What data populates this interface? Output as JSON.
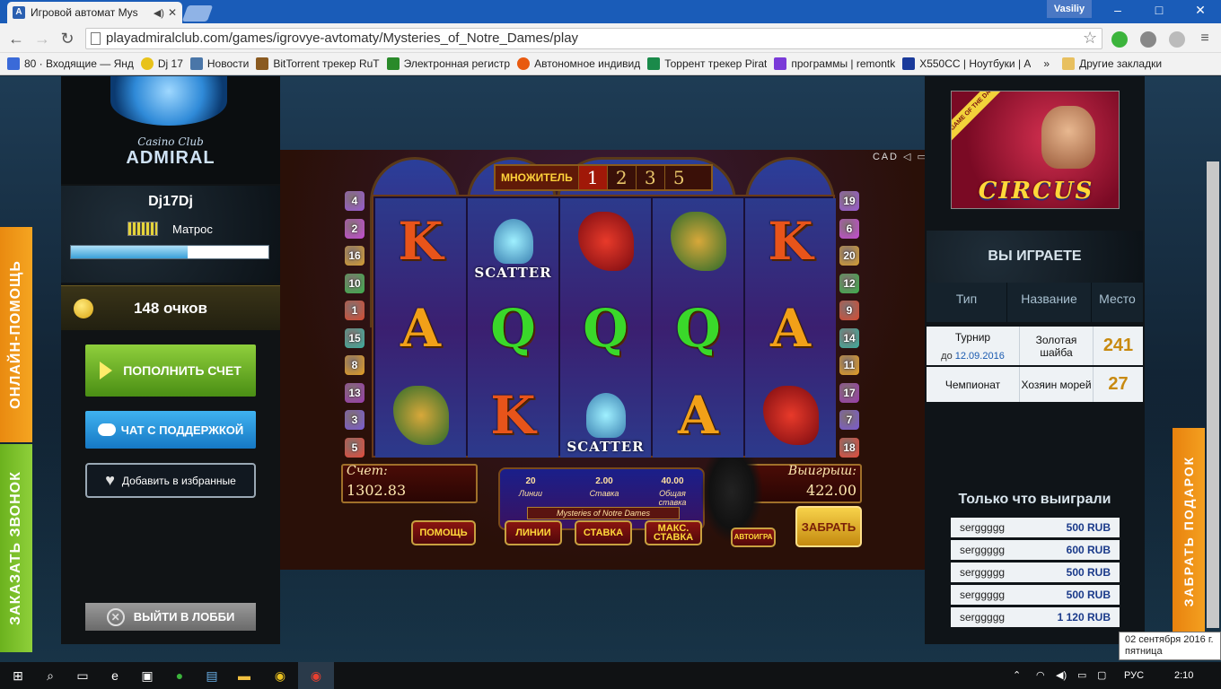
{
  "browser": {
    "tab_title": "Игровой автомат Mys",
    "tab_favicon": "A",
    "user": "Vasiliy",
    "window_controls": [
      "–",
      "□",
      "✕"
    ],
    "url": "playadmiralclub.com/games/igrovye-avtomaty/Mysteries_of_Notre_Dames/play",
    "bookmarks": [
      {
        "label": "80 · Входящие — Янд",
        "color": "#3a6ad8"
      },
      {
        "label": "Dj 17",
        "color": "#e8c21a"
      },
      {
        "label": "Новости",
        "color": "#4a76a8"
      },
      {
        "label": "BitTorrent трекер RuT",
        "color": "#8a5a20"
      },
      {
        "label": "Электронная регистр",
        "color": "#2a8a2a"
      },
      {
        "label": "Автономное индивид",
        "color": "#e85a10"
      },
      {
        "label": "Торрент трекер Pirat",
        "color": "#1a8a4a"
      },
      {
        "label": "программы | remontk",
        "color": "#7a3ad8"
      },
      {
        "label": "X550CC | Ноутбуки | A",
        "color": "#1a3a9a"
      }
    ],
    "bookmarks_more": "»",
    "other_bookmarks": "Другие закладки"
  },
  "casino": {
    "logo_sub": "Casino Club",
    "logo_main": "ADMIRAL",
    "username": "Dj17Dj",
    "rank": "Матрос",
    "level_progress": 0.59,
    "points": "148 очков",
    "btn_fill": "ПОПОЛНИТЬ СЧЕТ",
    "btn_chat": "ЧАТ С ПОДДЕРЖКОЙ",
    "btn_fav": "Добавить в избранные",
    "btn_exit": "ВЫЙТИ В ЛОББИ",
    "side_online": "ОНЛАЙН-ПОМОЩЬ",
    "side_call": "ЗАКАЗАТЬ ЗВОНОК",
    "side_gift": "ЗАБРАТЬ ПОДАРОК"
  },
  "game": {
    "multiplier_label": "МНОЖИТЕЛЬ",
    "multipliers": [
      "1",
      "2",
      "3",
      "5"
    ],
    "top_icons": "САD ◁ ▭ ⤢",
    "left_gems": [
      "4",
      "2",
      "16",
      "10",
      "1",
      "15",
      "8",
      "13",
      "3",
      "5"
    ],
    "right_gems": [
      "19",
      "6",
      "20",
      "12",
      "9",
      "14",
      "11",
      "17",
      "7",
      "18"
    ],
    "reels": [
      [
        {
          "t": "K",
          "c": "#e8541a"
        },
        {
          "t": "A",
          "c": "#f2a018"
        },
        {
          "t": "dragon-green"
        }
      ],
      [
        {
          "t": "goblet",
          "scatter": "SCATTER"
        },
        {
          "t": "Q",
          "c": "#3ad82a"
        },
        {
          "t": "K",
          "c": "#e8541a"
        }
      ],
      [
        {
          "t": "dragon-red"
        },
        {
          "t": "Q",
          "c": "#3ad82a"
        },
        {
          "t": "goblet",
          "scatter": "SCATTER"
        }
      ],
      [
        {
          "t": "dragon-green"
        },
        {
          "t": "Q",
          "c": "#3ad82a"
        },
        {
          "t": "A",
          "c": "#f2a018"
        }
      ],
      [
        {
          "t": "K",
          "c": "#e8541a"
        },
        {
          "t": "A",
          "c": "#f2a018"
        },
        {
          "t": "dragon-red"
        }
      ]
    ],
    "score_label": "Счет:",
    "score_value": "1302.83",
    "win_label": "Выигрыш:",
    "win_value": "422.00",
    "lines_value": "20",
    "lines_label": "Линии",
    "bet_value": "2.00",
    "bet_label": "Ставка",
    "total_value": "40.00",
    "total_label": "Общая ставка",
    "title": "Mysteries of Notre Dames",
    "btn_help": "ПОМОЩЬ",
    "btn_lines": "ЛИНИИ",
    "btn_bet": "СТАВКА",
    "btn_max_1": "МАКС.",
    "btn_max_2": "СТАВКА",
    "btn_auto": "АВТОИГРА",
    "btn_take": "ЗАБРАТЬ"
  },
  "right": {
    "promo_ribbon": "GAME OF THE DAY",
    "promo_title": "CIRCUS",
    "playing_title": "ВЫ ИГРАЕТЕ",
    "headers": [
      "Тип",
      "Название",
      "Место"
    ],
    "rows": [
      {
        "type": "Турнир",
        "date_prefix": "до",
        "date": "12.09.2016",
        "name": "Золотая шайба",
        "place": "241"
      },
      {
        "type": "Чемпионат",
        "date_prefix": "",
        "date": "",
        "name": "Хозяин морей",
        "place": "27"
      }
    ],
    "just_won_title": "Только что выиграли",
    "winners": [
      {
        "user": "serggggg",
        "amount": "500 RUB"
      },
      {
        "user": "serggggg",
        "amount": "600 RUB"
      },
      {
        "user": "serggggg",
        "amount": "500 RUB"
      },
      {
        "user": "serggggg",
        "amount": "500 RUB"
      },
      {
        "user": "serggggg",
        "amount": "1 120 RUB"
      }
    ]
  },
  "tooltip": {
    "line1": "02 сентября 2016 г.",
    "line2": "пятница"
  },
  "taskbar": {
    "lang": "РУС",
    "time": "2:10"
  }
}
